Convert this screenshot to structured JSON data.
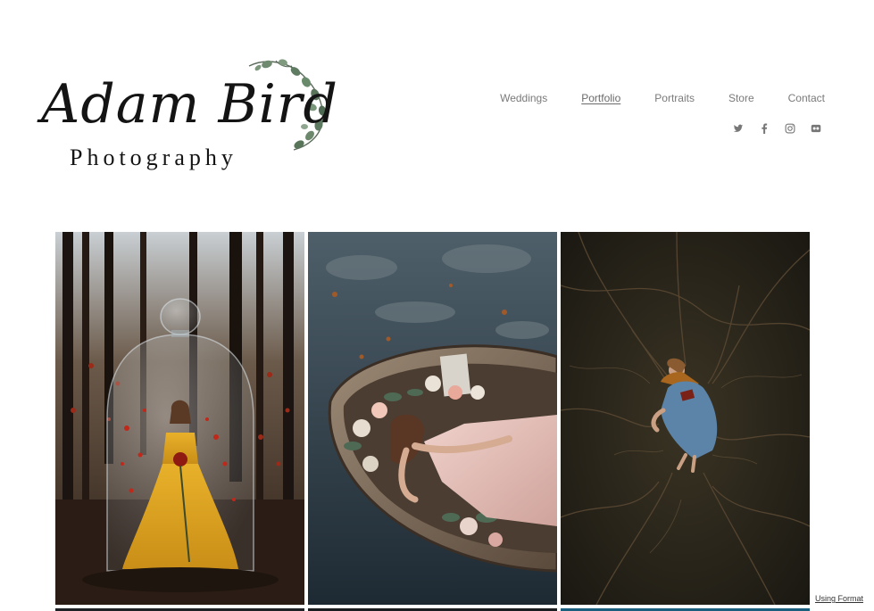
{
  "brand": {
    "name": "Adam Bird",
    "tagline": "Photography"
  },
  "nav": {
    "items": [
      {
        "label": "Weddings",
        "active": false
      },
      {
        "label": "Portfolio",
        "active": true
      },
      {
        "label": "Portraits",
        "active": false
      },
      {
        "label": "Store",
        "active": false
      },
      {
        "label": "Contact",
        "active": false
      }
    ]
  },
  "social": [
    "twitter-icon",
    "facebook-icon",
    "instagram-icon",
    "flickr-icon"
  ],
  "gallery": {
    "photos": [
      {
        "subject": "woman in yellow gown under glass bell jar in dark forest"
      },
      {
        "subject": "woman in pink dress lying in wooden boat with flowers"
      },
      {
        "subject": "woman in blue dress lying among roots"
      }
    ]
  },
  "footer": {
    "credit": "Using Format"
  },
  "colors": {
    "text": "#141414",
    "nav": "#7a7a7a",
    "accent_blue": "#1b5f7f"
  }
}
